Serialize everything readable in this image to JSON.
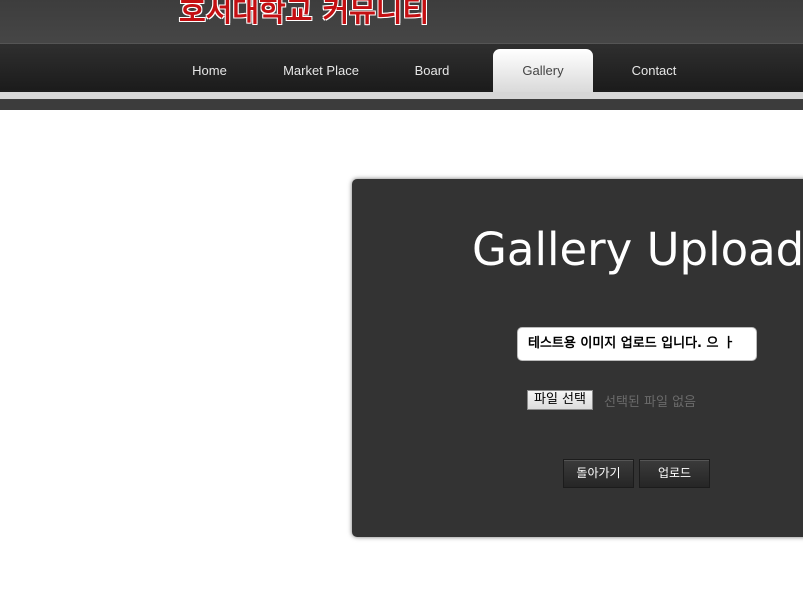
{
  "header": {
    "logo_text": "호서대학교 커뮤니티"
  },
  "nav": {
    "items": [
      {
        "label": "Home"
      },
      {
        "label": "Market Place"
      },
      {
        "label": "Board"
      },
      {
        "label": "Gallery",
        "active": true
      },
      {
        "label": "Contact"
      }
    ]
  },
  "upload": {
    "title": "Gallery Upload",
    "title_input_value": "테스트용 이미지 업로드 입니다. 으 ㅏ",
    "file_button_label": "파일 선택",
    "file_status": "선택된 파일 없음",
    "back_button_label": "돌아가기",
    "upload_button_label": "업로드"
  },
  "colors": {
    "logo": "#c40f12",
    "panel_bg": "#333333",
    "nav_bg": "#1f1f1f"
  }
}
